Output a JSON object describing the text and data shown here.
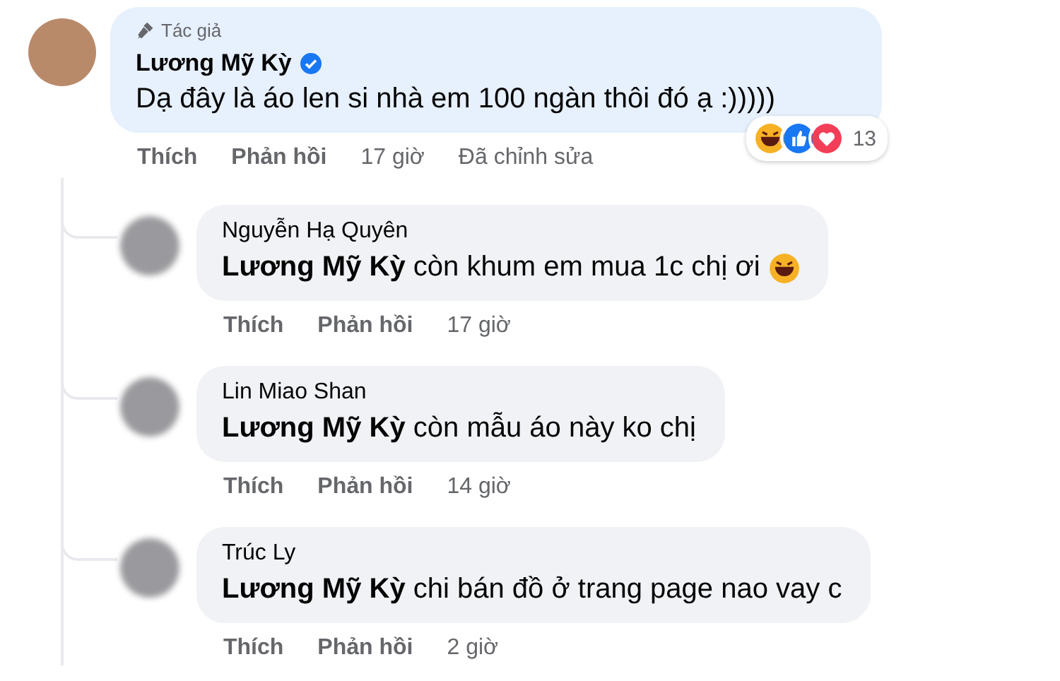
{
  "comment": {
    "author_badge": "Tác giả",
    "author": "Lương Mỹ Kỳ",
    "verified": true,
    "text": "Dạ đây là áo len si nhà em 100 ngàn thôi đó ạ :)))))",
    "reactions": {
      "count": "13"
    },
    "actions": [
      "Thích",
      "Phản hồi"
    ],
    "time": "17 giờ",
    "edited": "Đã chỉnh sửa"
  },
  "replies": [
    {
      "author": "Nguyễn Hạ Quyên",
      "text": "**Lương Mỹ Kỳ** còn khum em mua 1c chị ơi",
      "emoji": true,
      "actions": [
        "Thích",
        "Phản hồi"
      ],
      "time": "17 giờ"
    },
    {
      "author": "Lin Miao Shan",
      "text": "**Lương Mỹ Kỳ** còn mẫu áo này ko chị",
      "emoji": false,
      "actions": [
        "Thích",
        "Phản hồi"
      ],
      "time": "14 giờ"
    },
    {
      "author": "Trúc Ly",
      "text": "**Lương Mỹ Kỳ** chi bán đồ ở trang page nao vay c",
      "emoji": false,
      "actions": [
        "Thích",
        "Phản hồi"
      ],
      "time": "2 giờ"
    }
  ]
}
